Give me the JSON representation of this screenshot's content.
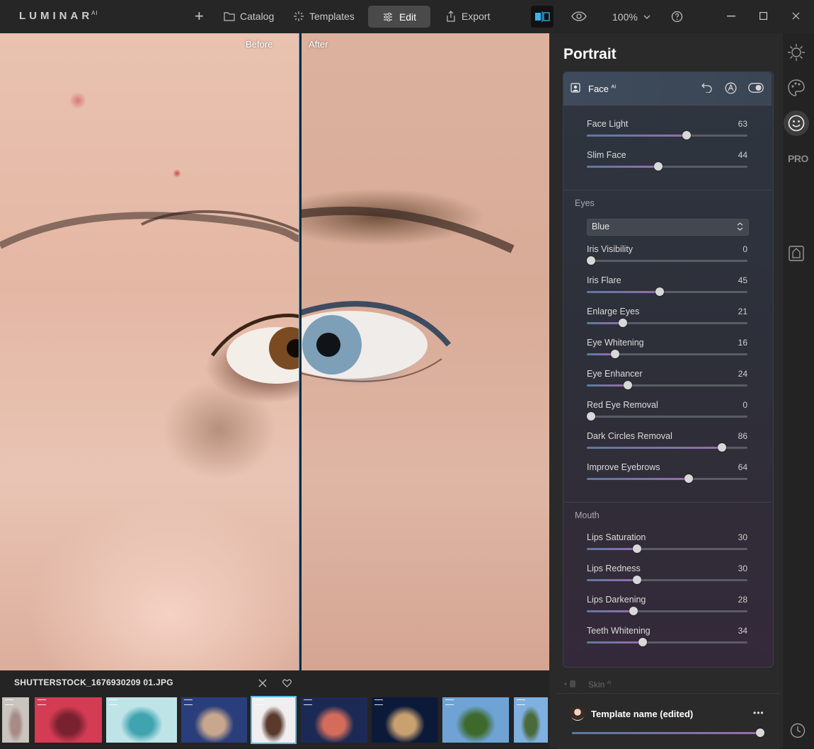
{
  "app": {
    "logo": "LUMINAR",
    "logo_sup": "AI"
  },
  "nav": {
    "catalog": "Catalog",
    "templates": "Templates",
    "edit": "Edit",
    "export": "Export",
    "zoom": "100%"
  },
  "canvas": {
    "before_label": "Before",
    "after_label": "After"
  },
  "filmstrip": {
    "filename": "SHUTTERSTOCK_1676930209 01.JPG",
    "thumbs": [
      {
        "color_a": "#c9c4bd",
        "color_b": "#a88a86"
      },
      {
        "color_a": "#d43c54",
        "color_b": "#7a2130"
      },
      {
        "color_a": "#bfe4e8",
        "color_b": "#3fa3b0"
      },
      {
        "color_a": "#2a3e7c",
        "color_b": "#c9a78e"
      },
      {
        "color_a": "#f0eef0",
        "color_b": "#5a3a2c"
      },
      {
        "color_a": "#1b2a55",
        "color_b": "#d46c5c"
      },
      {
        "color_a": "#0c1a3a",
        "color_b": "#c9a070"
      },
      {
        "color_a": "#6fa3d6",
        "color_b": "#3d6a2c"
      },
      {
        "color_a": "#7fb0e0",
        "color_b": "#4a6a3a"
      }
    ]
  },
  "panel": {
    "title": "Portrait",
    "face_header": "Face",
    "face_header_sup": "AI",
    "face_sliders": [
      {
        "label": "Face Light",
        "value": 63
      },
      {
        "label": "Slim Face",
        "value": 44
      }
    ],
    "eyes_title": "Eyes",
    "eyes_color": "Blue",
    "eyes_sliders": [
      {
        "label": "Iris Visibility",
        "value": 0
      },
      {
        "label": "Iris Flare",
        "value": 45
      },
      {
        "label": "Enlarge Eyes",
        "value": 21
      },
      {
        "label": "Eye Whitening",
        "value": 16
      },
      {
        "label": "Eye Enhancer",
        "value": 24
      },
      {
        "label": "Red Eye Removal",
        "value": 0
      },
      {
        "label": "Dark Circles Removal",
        "value": 86
      },
      {
        "label": "Improve Eyebrows",
        "value": 64
      }
    ],
    "mouth_title": "Mouth",
    "mouth_sliders": [
      {
        "label": "Lips Saturation",
        "value": 30
      },
      {
        "label": "Lips Redness",
        "value": 30
      },
      {
        "label": "Lips Darkening",
        "value": 28
      },
      {
        "label": "Teeth Whitening",
        "value": 34
      }
    ],
    "skin_label": "Skin",
    "skin_sup": "AI"
  },
  "template": {
    "name": "Template name (edited)",
    "more": "•••",
    "amount": 1.0
  },
  "rail": {
    "pro": "PRO"
  }
}
